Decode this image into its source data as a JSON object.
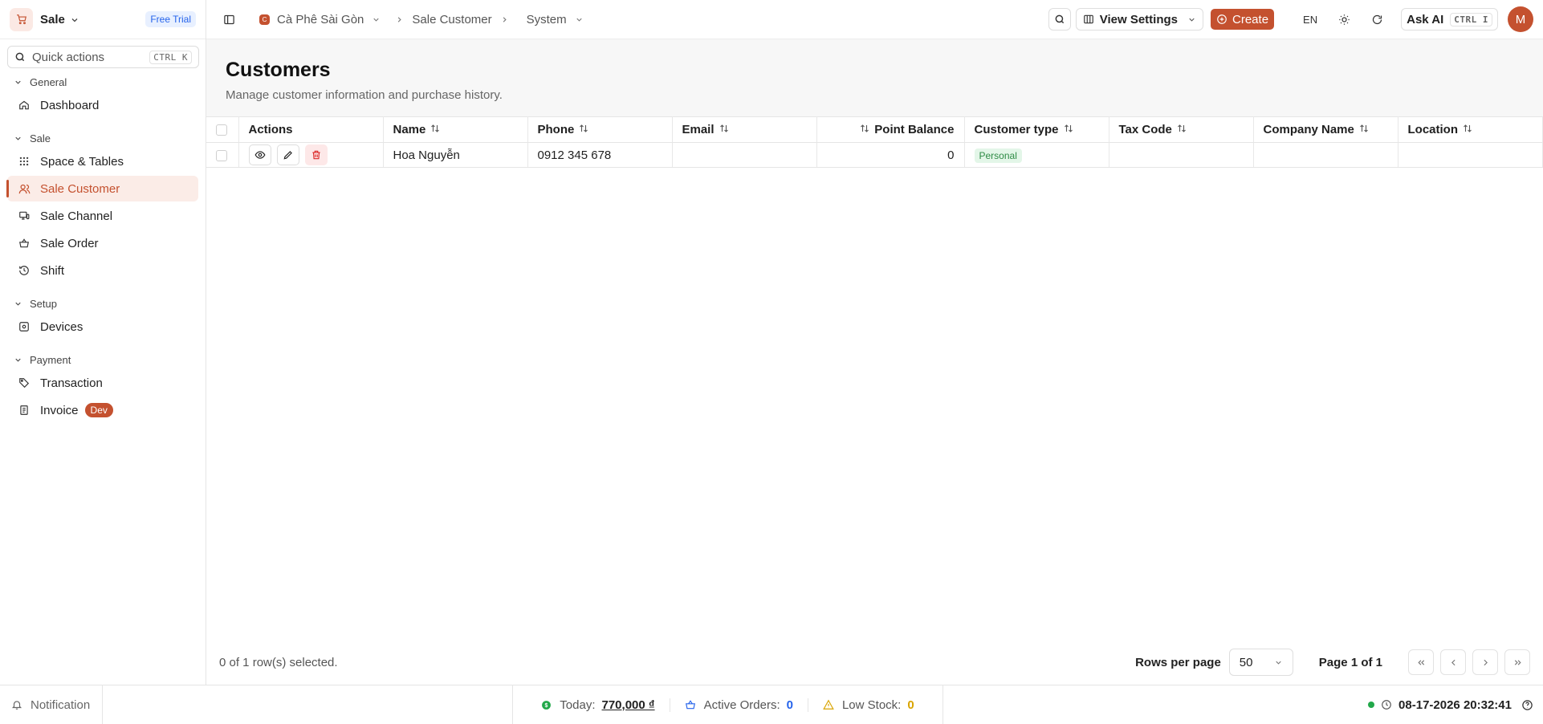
{
  "app": {
    "name": "Sale",
    "trial_badge": "Free Trial"
  },
  "quick_actions": {
    "label": "Quick actions",
    "shortcut": "CTRL K"
  },
  "sidebar": {
    "groups": [
      {
        "label": "General",
        "items": [
          {
            "label": "Dashboard",
            "icon": "home-icon"
          }
        ]
      },
      {
        "label": "Sale",
        "items": [
          {
            "label": "Space & Tables",
            "icon": "grid-icon"
          },
          {
            "label": "Sale Customer",
            "icon": "users-icon",
            "active": true
          },
          {
            "label": "Sale Channel",
            "icon": "monitor-icon"
          },
          {
            "label": "Sale Order",
            "icon": "basket-icon"
          },
          {
            "label": "Shift",
            "icon": "history-icon"
          }
        ]
      },
      {
        "label": "Setup",
        "items": [
          {
            "label": "Devices",
            "icon": "device-icon"
          }
        ]
      },
      {
        "label": "Payment",
        "items": [
          {
            "label": "Transaction",
            "icon": "tag-icon"
          },
          {
            "label": "Invoice",
            "icon": "receipt-icon",
            "badge": "Dev"
          }
        ]
      }
    ]
  },
  "header": {
    "store": "Cà Phê Sài Gòn",
    "store_logo_letter": "C",
    "crumb_page": "Sale Customer",
    "crumb_system": "System",
    "view_settings": "View Settings",
    "create": "Create",
    "lang": "EN",
    "ask_ai": "Ask AI",
    "ask_ai_shortcut": "CTRL I",
    "avatar": "M"
  },
  "page": {
    "title": "Customers",
    "subtitle": "Manage customer information and purchase history."
  },
  "table": {
    "columns": [
      "Actions",
      "Name",
      "Phone",
      "Email",
      "Point Balance",
      "Customer type",
      "Tax Code",
      "Company Name",
      "Location"
    ],
    "rows": [
      {
        "name": "Hoa Nguyễn",
        "phone": "0912 345 678",
        "email": "",
        "points": "0",
        "type": "Personal",
        "tax_code": "",
        "company": "",
        "location": ""
      }
    ]
  },
  "footer": {
    "selection": "0 of 1 row(s) selected.",
    "rows_per_page_label": "Rows per page",
    "rows_per_page": "50",
    "page_info": "Page 1 of 1"
  },
  "status": {
    "notification": "Notification",
    "today_label": "Today:",
    "today_value": "770,000 ₫",
    "active_orders_label": "Active Orders:",
    "active_orders_value": "0",
    "low_stock_label": "Low Stock:",
    "low_stock_value": "0",
    "datetime": "08-17-2026 20:32:41"
  },
  "colors": {
    "accent": "#c4512f",
    "blue": "#2563eb",
    "green": "#22a84a",
    "amber": "#d9a400"
  }
}
